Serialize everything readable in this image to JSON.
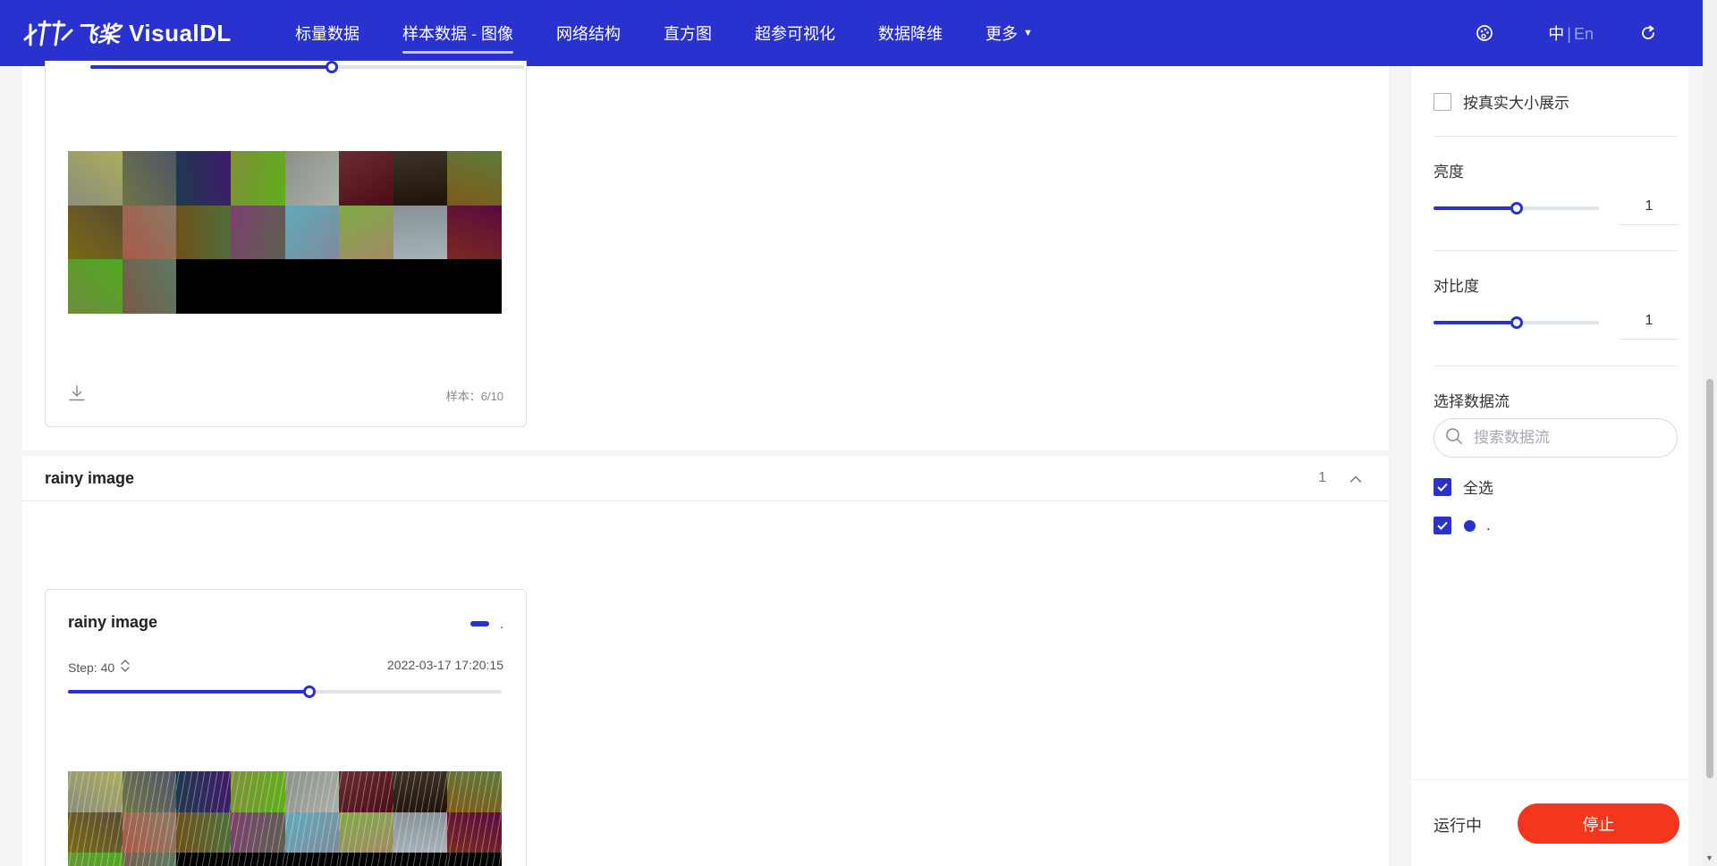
{
  "header": {
    "logo_cn": "飞桨",
    "logo_text": "VisualDL",
    "nav": [
      {
        "label": "标量数据",
        "active": false
      },
      {
        "label": "样本数据 - 图像",
        "active": true
      },
      {
        "label": "网络结构",
        "active": false
      },
      {
        "label": "直方图",
        "active": false
      },
      {
        "label": "超参可视化",
        "active": false
      },
      {
        "label": "数据降维",
        "active": false
      },
      {
        "label": "更多",
        "active": false,
        "dropdown": true
      }
    ],
    "lang_zh": "中",
    "lang_sep": "|",
    "lang_en": "En",
    "icons": {
      "theme": "palette-icon",
      "refresh": "refresh-icon",
      "more_caret": "caret-down-icon"
    },
    "color": "#2932cf"
  },
  "groups": [
    {
      "card": {
        "slider_fraction": 0.556,
        "sample_label": "样本：6/10",
        "tone": "original"
      }
    },
    {
      "title": "rainy image",
      "count": "1",
      "card": {
        "title": "rainy image",
        "legend_text": ".",
        "step_label": "Step: 40",
        "timestamp": "2022-03-17 17:20:15",
        "slider_fraction": 0.556,
        "tone": "rainy"
      }
    }
  ],
  "sidebar": {
    "real_size_label": "按真实大小展示",
    "real_size_checked": false,
    "brightness": {
      "label": "亮度",
      "value": "1",
      "fraction": 0.5
    },
    "contrast": {
      "label": "对比度",
      "value": "1",
      "fraction": 0.5
    },
    "streams_title": "选择数据流",
    "search_placeholder": "搜索数据流",
    "select_all_label": "全选",
    "stream_label": ".",
    "stream_color": "#2932cf",
    "run_status": "运行中",
    "stop_label": "停止",
    "stop_color": "#f3361c"
  },
  "image_palette": [
    "#8b8d7c",
    "#6f7546",
    "#1f3a4d",
    "#7f8f3a",
    "#8b9189",
    "#6b2d33",
    "#3d3328",
    "#5f7a3a",
    "#5a4a33",
    "#8a7a66",
    "#4f6f3a",
    "#5c604f",
    "#7f8a9a",
    "#a08a66",
    "#a7b2b8",
    "#7a2a1e",
    "#6f8a3f",
    "#7a5a44",
    "#000000",
    "#000000",
    "#000000",
    "#000000",
    "#000000",
    "#000000"
  ]
}
